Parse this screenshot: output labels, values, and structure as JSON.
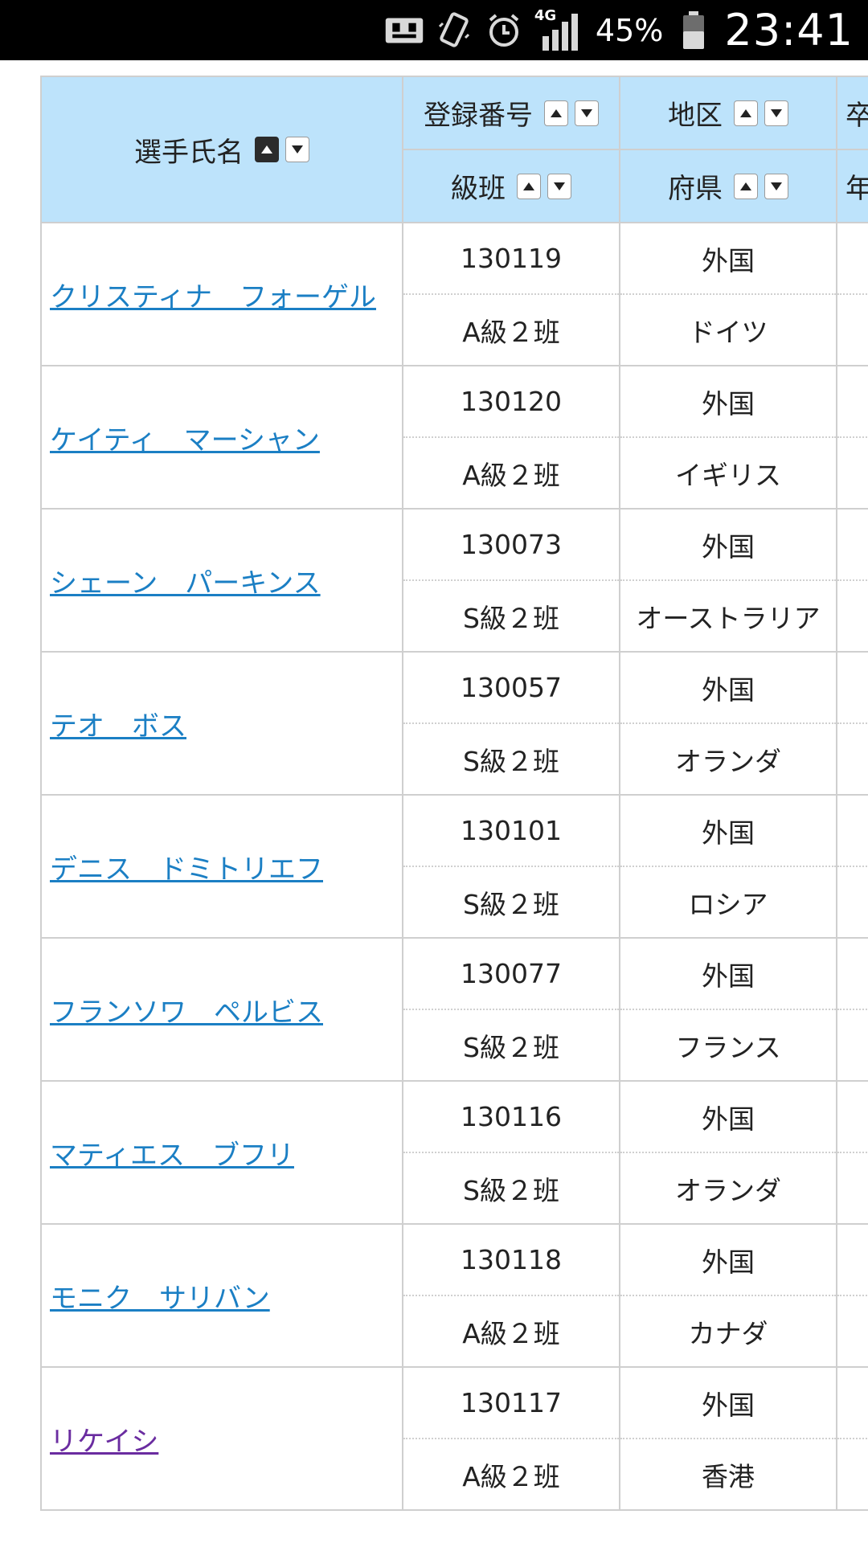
{
  "status_bar": {
    "icons": [
      "voicemail-icon",
      "vibrate-icon",
      "alarm-icon",
      "signal-icon",
      "battery-icon"
    ],
    "network": "4G",
    "battery_percent": "45%",
    "time": "23:41"
  },
  "table": {
    "header": {
      "name": "選手氏名",
      "reg_no": "登録番号",
      "rank": "級班",
      "district": "地区",
      "prefecture": "府県",
      "extra_top": "卒",
      "extra_bottom": "年"
    },
    "colors": {
      "header_bg": "#bde3fb",
      "link": "#1b7fc4",
      "visited_link": "#6a2ca0"
    },
    "rows": [
      {
        "name": "クリスティナ　フォーゲル",
        "reg_no": "130119",
        "rank": "A級２班",
        "district": "外国",
        "prefecture": "ドイツ"
      },
      {
        "name": "ケイティ　マーシャン",
        "reg_no": "130120",
        "rank": "A級２班",
        "district": "外国",
        "prefecture": "イギリス"
      },
      {
        "name": "シェーン　パーキンス",
        "reg_no": "130073",
        "rank": "S級２班",
        "district": "外国",
        "prefecture": "オーストラリア"
      },
      {
        "name": "テオ　ボス",
        "reg_no": "130057",
        "rank": "S級２班",
        "district": "外国",
        "prefecture": "オランダ"
      },
      {
        "name": "デニス　ドミトリエフ",
        "reg_no": "130101",
        "rank": "S級２班",
        "district": "外国",
        "prefecture": "ロシア"
      },
      {
        "name": "フランソワ　ペルビス",
        "reg_no": "130077",
        "rank": "S級２班",
        "district": "外国",
        "prefecture": "フランス"
      },
      {
        "name": "マティエス　ブフリ",
        "reg_no": "130116",
        "rank": "S級２班",
        "district": "外国",
        "prefecture": "オランダ"
      },
      {
        "name": "モニク　サリバン",
        "reg_no": "130118",
        "rank": "A級２班",
        "district": "外国",
        "prefecture": "カナダ"
      },
      {
        "name": "リケイシ",
        "reg_no": "130117",
        "rank": "A級２班",
        "district": "外国",
        "prefecture": "香港"
      }
    ]
  }
}
